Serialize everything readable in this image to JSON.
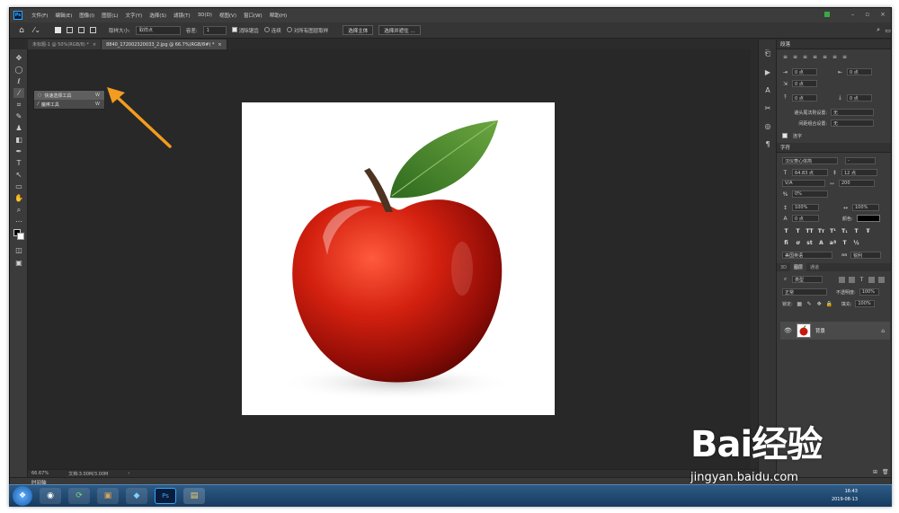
{
  "app": {
    "logo": "Ps"
  },
  "menubar": {
    "items": [
      "文件(F)",
      "编辑(E)",
      "图像(I)",
      "图层(L)",
      "文字(Y)",
      "选择(S)",
      "滤镜(T)",
      "3D(D)",
      "视图(V)",
      "窗口(W)",
      "帮助(H)"
    ],
    "window_controls": [
      "–",
      "▫",
      "×"
    ]
  },
  "options_bar": {
    "sample_size_label": "取样大小:",
    "sample_size_value": "取样点",
    "tolerance_label": "容差:",
    "tolerance_value": "1",
    "anti_alias": "消除锯齿",
    "contiguous": "连续",
    "sample_all_layers": "对所有图层取样",
    "select_subject": "选择主体",
    "select_and_mask": "选择并遮住 ..."
  },
  "tabs": [
    {
      "label": "未标题-1 @ 50%(RGB/8) *",
      "active": false
    },
    {
      "label": "8840_172002320033_2.jpg @ 66.7%(RGB/8#) *",
      "active": true
    }
  ],
  "flyout": {
    "items": [
      {
        "label": "快速选择工具",
        "key": "W",
        "selected": true
      },
      {
        "label": "魔棒工具",
        "key": "W",
        "selected": false
      }
    ]
  },
  "status": {
    "zoom": "66.67%",
    "doc": "文档:3.00M/3.00M"
  },
  "timeline": {
    "label": "时间轴"
  },
  "paragraph_panel": {
    "title": "段落",
    "indent_left": "0 点",
    "indent_right": "0 点",
    "indent_first": "0 点",
    "space_before": "0 点",
    "space_after": "0 点",
    "kinsoku_label": "避头尾法则设置:",
    "kinsoku_value": "无",
    "mojikumi_label": "间距组合设置:",
    "mojikumi_value": "无",
    "hyphenate": "连字"
  },
  "character_panel": {
    "title": "字符",
    "font": "汉仪菱心体简",
    "style": "-",
    "size": "64.83 点",
    "leading": "12 点",
    "kerning": "V/A",
    "tracking": "200",
    "scale_pct": "0%",
    "vscale": "100%",
    "hscale": "100%",
    "baseline": "0 点",
    "color_label": "颜色:",
    "language": "美国英语",
    "aa_label": "aa",
    "aa_value": "锐利"
  },
  "layers_panel": {
    "tabs": [
      {
        "label": "3D",
        "active": false
      },
      {
        "label": "图层",
        "active": true
      },
      {
        "label": "通道",
        "active": false
      }
    ],
    "kind": "类型",
    "blend_mode": "正常",
    "opacity_label": "不透明度:",
    "opacity_value": "100%",
    "lock_label": "锁定:",
    "fill_label": "填充:",
    "fill_value": "100%",
    "layer_name": "背景"
  },
  "taskbar": {
    "time": "16:43",
    "date": "2019-08-13"
  },
  "watermark": {
    "big": "Bai经验",
    "small": "jingyan.baidu.com"
  },
  "colors": {
    "accent": "#31a8ff",
    "annotation_arrow": "#f39c1f",
    "apple_red": "#c41a10",
    "leaf_green": "#4a8a2a"
  }
}
